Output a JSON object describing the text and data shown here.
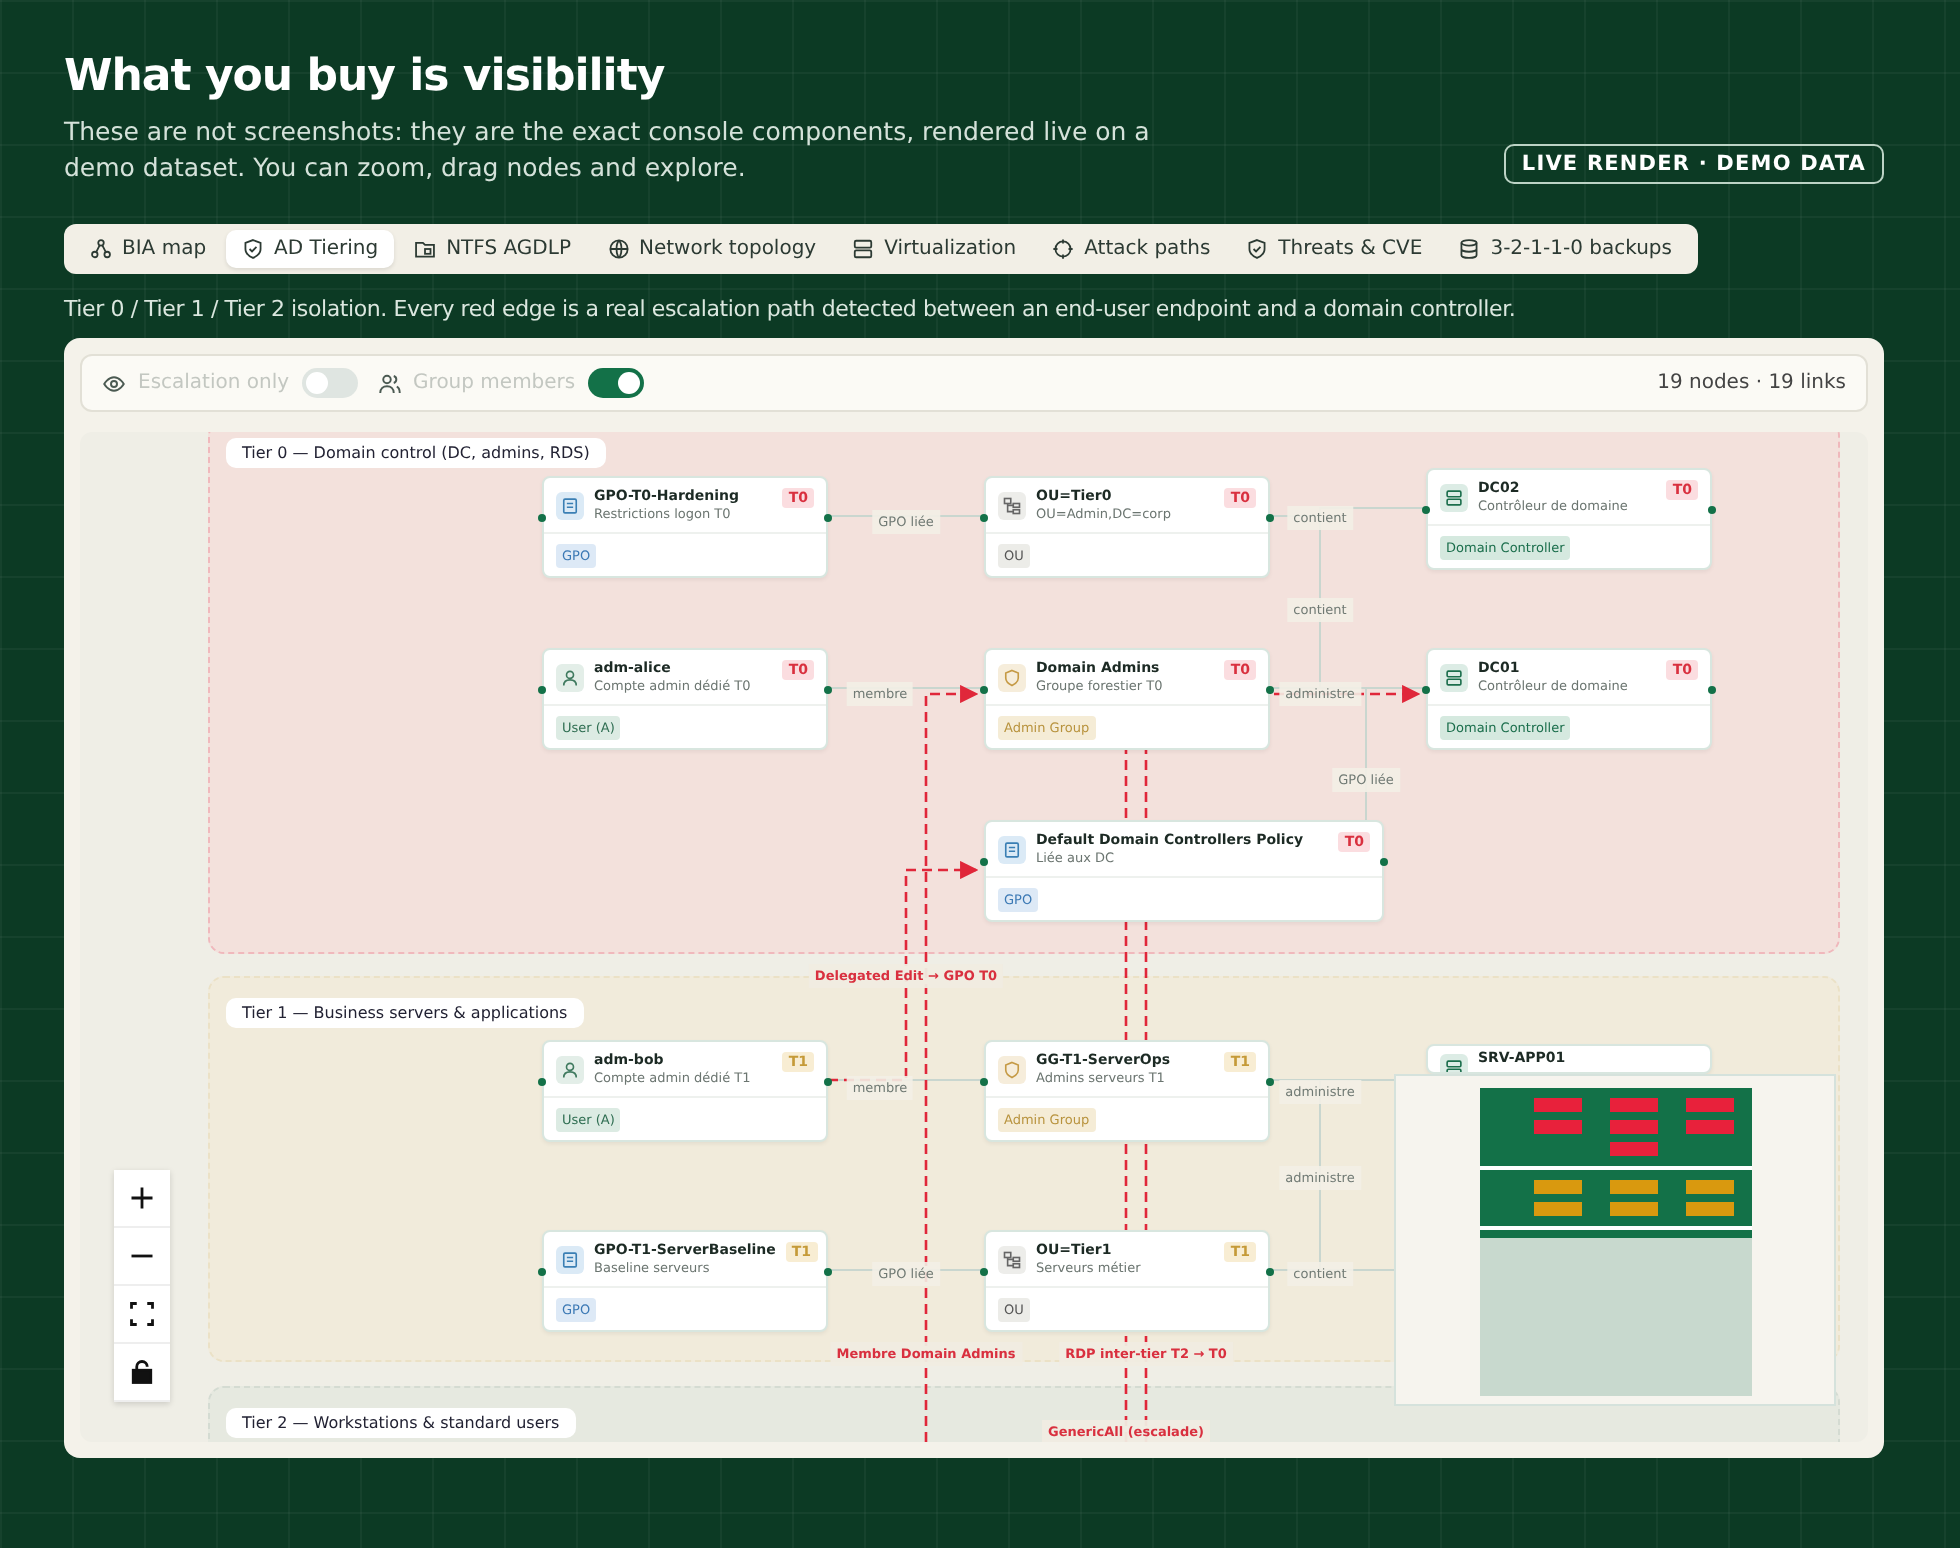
{
  "header": {
    "title": "What you buy is visibility",
    "subtitle": "These are not screenshots: they are the exact console components, rendered live on a demo dataset. You can zoom, drag nodes and explore.",
    "badge": "LIVE RENDER · DEMO DATA"
  },
  "tabs": [
    {
      "label": "BIA map",
      "selected": false
    },
    {
      "label": "AD Tiering",
      "selected": true
    },
    {
      "label": "NTFS AGDLP",
      "selected": false
    },
    {
      "label": "Network topology",
      "selected": false
    },
    {
      "label": "Virtualization",
      "selected": false
    },
    {
      "label": "Attack paths",
      "selected": false
    },
    {
      "label": "Threats & CVE",
      "selected": false
    },
    {
      "label": "3-2-1-1-0 backups",
      "selected": false
    }
  ],
  "caption": "Tier 0 / Tier 1 / Tier 2 isolation. Every red edge is a real escalation path detected between an end-user endpoint and a domain controller.",
  "toolbar": {
    "toggles": [
      {
        "label": "Escalation only",
        "on": false
      },
      {
        "label": "Group members",
        "on": true
      }
    ],
    "stats": "19 nodes · 19 links"
  },
  "zones": [
    {
      "label": "Tier 0 — Domain control (DC, admins, RDS)"
    },
    {
      "label": "Tier 1 — Business servers & applications"
    },
    {
      "label": "Tier 2 — Workstations & standard users"
    }
  ],
  "nodes": [
    {
      "kind": "gpo",
      "title": "GPO-T0-Hardening",
      "subtitle": "Restrictions logon T0",
      "badge": "T0",
      "tag": "GPO"
    },
    {
      "kind": "ou",
      "title": "OU=Tier0",
      "subtitle": "OU=Admin,DC=corp",
      "badge": "T0",
      "tag": "OU"
    },
    {
      "kind": "server",
      "title": "DC02",
      "subtitle": "Contrôleur de domaine",
      "badge": "T0",
      "tag": "Domain Controller"
    },
    {
      "kind": "user",
      "title": "adm-alice",
      "subtitle": "Compte admin dédié T0",
      "badge": "T0",
      "tag": "User (A)"
    },
    {
      "kind": "group",
      "title": "Domain Admins",
      "subtitle": "Groupe forestier T0",
      "badge": "T0",
      "tag": "Admin Group"
    },
    {
      "kind": "server",
      "title": "DC01",
      "subtitle": "Contrôleur de domaine",
      "badge": "T0",
      "tag": "Domain Controller"
    },
    {
      "kind": "gpo",
      "title": "Default Domain Controllers Policy",
      "subtitle": "Liée aux DC",
      "badge": "T0",
      "tag": "GPO"
    },
    {
      "kind": "user",
      "title": "adm-bob",
      "subtitle": "Compte admin dédié T1",
      "badge": "T1",
      "tag": "User (A)"
    },
    {
      "kind": "group",
      "title": "GG-T1-ServerOps",
      "subtitle": "Admins serveurs T1",
      "badge": "T1",
      "tag": "Admin Group"
    },
    {
      "kind": "server",
      "title": "SRV-APP01"
    },
    {
      "kind": "gpo",
      "title": "GPO-T1-ServerBaseline",
      "subtitle": "Baseline serveurs",
      "badge": "T1",
      "tag": "GPO"
    },
    {
      "kind": "ou",
      "title": "OU=Tier1",
      "subtitle": "Serveurs métier",
      "badge": "T1",
      "tag": "OU"
    }
  ],
  "edge_labels": [
    {
      "text": "GPO liée",
      "kind": "relation"
    },
    {
      "text": "contient",
      "kind": "relation"
    },
    {
      "text": "contient",
      "kind": "relation"
    },
    {
      "text": "membre",
      "kind": "relation"
    },
    {
      "text": "administre",
      "kind": "relation"
    },
    {
      "text": "GPO liée",
      "kind": "relation"
    },
    {
      "text": "membre",
      "kind": "relation"
    },
    {
      "text": "administre",
      "kind": "relation"
    },
    {
      "text": "administre",
      "kind": "relation"
    },
    {
      "text": "GPO liée",
      "kind": "relation"
    },
    {
      "text": "contient",
      "kind": "relation"
    },
    {
      "text": "Delegated Edit → GPO T0",
      "kind": "escalation"
    },
    {
      "text": "Membre Domain Admins",
      "kind": "escalation"
    },
    {
      "text": "RDP inter-tier T2 → T0",
      "kind": "escalation"
    },
    {
      "text": "GenericAll (escalade)",
      "kind": "escalation"
    }
  ]
}
